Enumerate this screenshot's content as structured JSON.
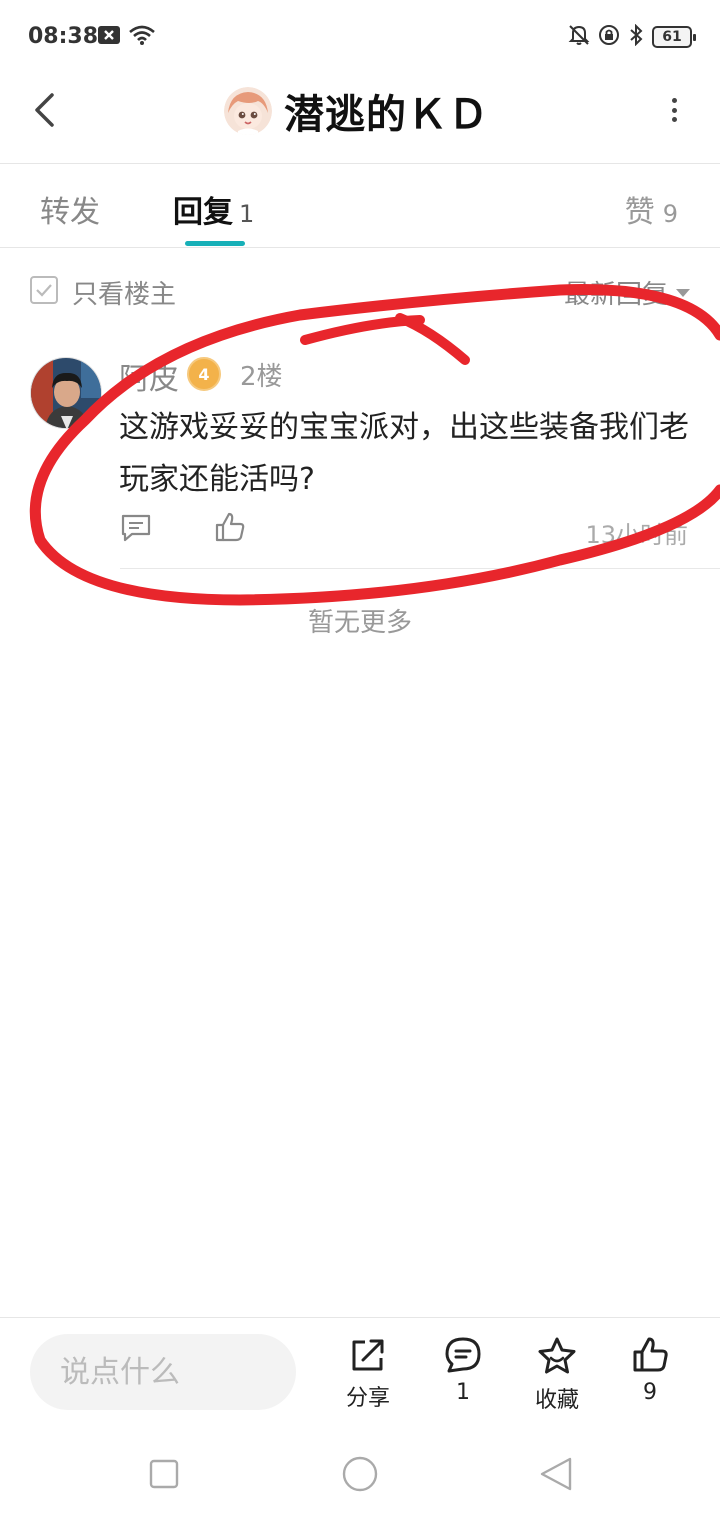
{
  "status_bar": {
    "time": "08:38",
    "battery": "61",
    "icons": [
      "close-box-icon",
      "wifi-icon",
      "bell-muted-icon",
      "lock-rotation-icon",
      "bluetooth-icon",
      "battery-icon"
    ]
  },
  "header": {
    "title": "潜逃的ＫＤ"
  },
  "tabs": {
    "forward": "转发",
    "reply": "回复",
    "reply_count": "1",
    "like": "赞",
    "like_count": "9"
  },
  "filter": {
    "owner_only": "只看楼主",
    "sort": "最新回复"
  },
  "reply": {
    "author": "阿皮",
    "level": "4",
    "floor": "2楼",
    "text": "这游戏妥妥的宝宝派对，出这些装备我们老玩家还能活吗?",
    "time": "13小时前"
  },
  "no_more": "暂无更多",
  "bottom_bar": {
    "input_placeholder": "说点什么",
    "share": "分享",
    "comment_count": "1",
    "favorite": "收藏",
    "like_count": "9"
  },
  "colors": {
    "accent": "#17b0b8",
    "annotation": "#e8262c"
  }
}
